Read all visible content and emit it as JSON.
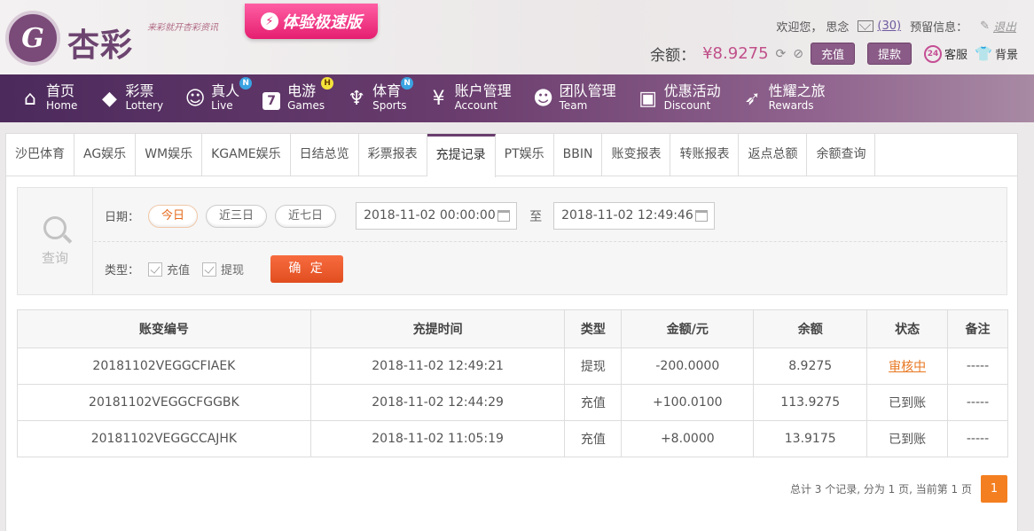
{
  "header": {
    "logo_mark": "G",
    "logo_text": "杏彩",
    "slogan": "来彩就开杏彩资讯",
    "speed_badge": "体验极速版",
    "welcome": "欢迎您，",
    "username": "思念",
    "mail_count": "(30)",
    "reserve_label": "预留信息：",
    "logout": "退出",
    "balance_label": "余额：",
    "balance_value": "¥8.9275",
    "deposit_btn": "充值",
    "withdraw_btn": "提款",
    "service_label": "客服",
    "service_icon_text": "24",
    "bg_label": "背景"
  },
  "nav": [
    {
      "cn": "首页",
      "en": "Home",
      "icon": "home-icon"
    },
    {
      "cn": "彩票",
      "en": "Lottery",
      "icon": "ticket-icon"
    },
    {
      "cn": "真人",
      "en": "Live",
      "icon": "dealer-icon",
      "badge": "N"
    },
    {
      "cn": "电游",
      "en": "Games",
      "icon": "seven-icon",
      "badge": "H"
    },
    {
      "cn": "体育",
      "en": "Sports",
      "icon": "trophy-icon",
      "badge": "N"
    },
    {
      "cn": "账户管理",
      "en": "Account",
      "icon": "coin-icon"
    },
    {
      "cn": "团队管理",
      "en": "Team",
      "icon": "team-icon"
    },
    {
      "cn": "优惠活动",
      "en": "Discount",
      "icon": "gift-icon"
    },
    {
      "cn": "性耀之旅",
      "en": "Rewards",
      "icon": "rocket-icon"
    }
  ],
  "tabs": [
    "沙巴体育",
    "AG娱乐",
    "WM娱乐",
    "KGAME娱乐",
    "日结总览",
    "彩票报表",
    "充提记录",
    "PT娱乐",
    "BBIN",
    "账变报表",
    "转账报表",
    "返点总额",
    "余额查询"
  ],
  "active_tab": "充提记录",
  "filter": {
    "search_label": "查询",
    "date_label": "日期：",
    "quick_dates": [
      "今日",
      "近三日",
      "近七日"
    ],
    "start_date": "2018-11-02 00:00:00",
    "to_label": "至",
    "end_date": "2018-11-02 12:49:46",
    "type_label": "类型：",
    "types": [
      "充值",
      "提现"
    ],
    "confirm": "确 定"
  },
  "table": {
    "headers": [
      "账变编号",
      "充提时间",
      "类型",
      "金额/元",
      "余额",
      "状态",
      "备注"
    ],
    "rows": [
      {
        "id": "20181102VEGGCFIAEK",
        "time": "2018-11-02 12:49:21",
        "type": "提现",
        "amount": "-200.0000",
        "balance": "8.9275",
        "status": "审核中",
        "note": "-----"
      },
      {
        "id": "20181102VEGGCFGGBK",
        "time": "2018-11-02 12:44:29",
        "type": "充值",
        "amount": "+100.0100",
        "balance": "113.9275",
        "status": "已到账",
        "note": "-----"
      },
      {
        "id": "20181102VEGGCCAJHK",
        "time": "2018-11-02 11:05:19",
        "type": "充值",
        "amount": "+8.0000",
        "balance": "13.9175",
        "status": "已到账",
        "note": "-----"
      }
    ]
  },
  "pager": {
    "summary": "总计 3 个记录, 分为 1 页, 当前第 1 页",
    "current": "1"
  },
  "colors": {
    "accent": "#6a3d6e",
    "negative": "#2d9a2d",
    "positive": "#e23b3b",
    "pending": "#e87722",
    "confirm": "#e14e1f"
  }
}
